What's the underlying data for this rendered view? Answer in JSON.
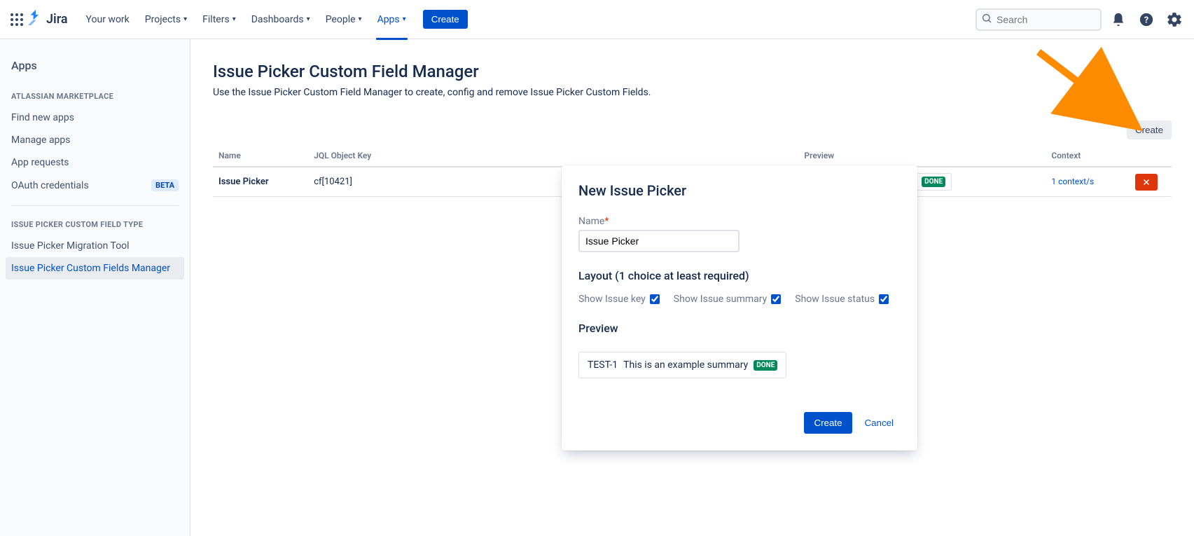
{
  "topnav": {
    "brand": "Jira",
    "items": [
      "Your work",
      "Projects",
      "Filters",
      "Dashboards",
      "People",
      "Apps"
    ],
    "create": "Create",
    "search_placeholder": "Search"
  },
  "sidebar": {
    "title": "Apps",
    "section1": "Atlassian Marketplace",
    "items1": [
      "Find new apps",
      "Manage apps",
      "App requests",
      "OAuth credentials"
    ],
    "beta_badge": "BETA",
    "section2": "Issue Picker Custom Field Type",
    "items2": [
      "Issue Picker Migration Tool",
      "Issue Picker Custom Fields Manager"
    ]
  },
  "page": {
    "title": "Issue Picker Custom Field Manager",
    "description": "Use the Issue Picker Custom Field Manager to create, config and remove Issue Picker Custom Fields.",
    "create_button": "Create"
  },
  "table": {
    "headers": {
      "name": "Name",
      "jql": "JQL Object Key",
      "preview": "Preview",
      "context": "Context"
    },
    "row": {
      "name": "Issue Picker",
      "jql": "cf[10421]",
      "preview_summary": "This is an example summary",
      "preview_status": "DONE",
      "context": "1 context/s"
    }
  },
  "dialog": {
    "title": "New Issue Picker",
    "name_label": "Name",
    "name_value": "Issue Picker",
    "layout_heading": "Layout (1 choice at least required)",
    "check_key": "Show Issue key",
    "check_summary": "Show Issue summary",
    "check_status": "Show Issue status",
    "preview_heading": "Preview",
    "preview_key": "TEST-1",
    "preview_summary": "This is an example summary",
    "preview_status": "DONE",
    "create": "Create",
    "cancel": "Cancel"
  }
}
